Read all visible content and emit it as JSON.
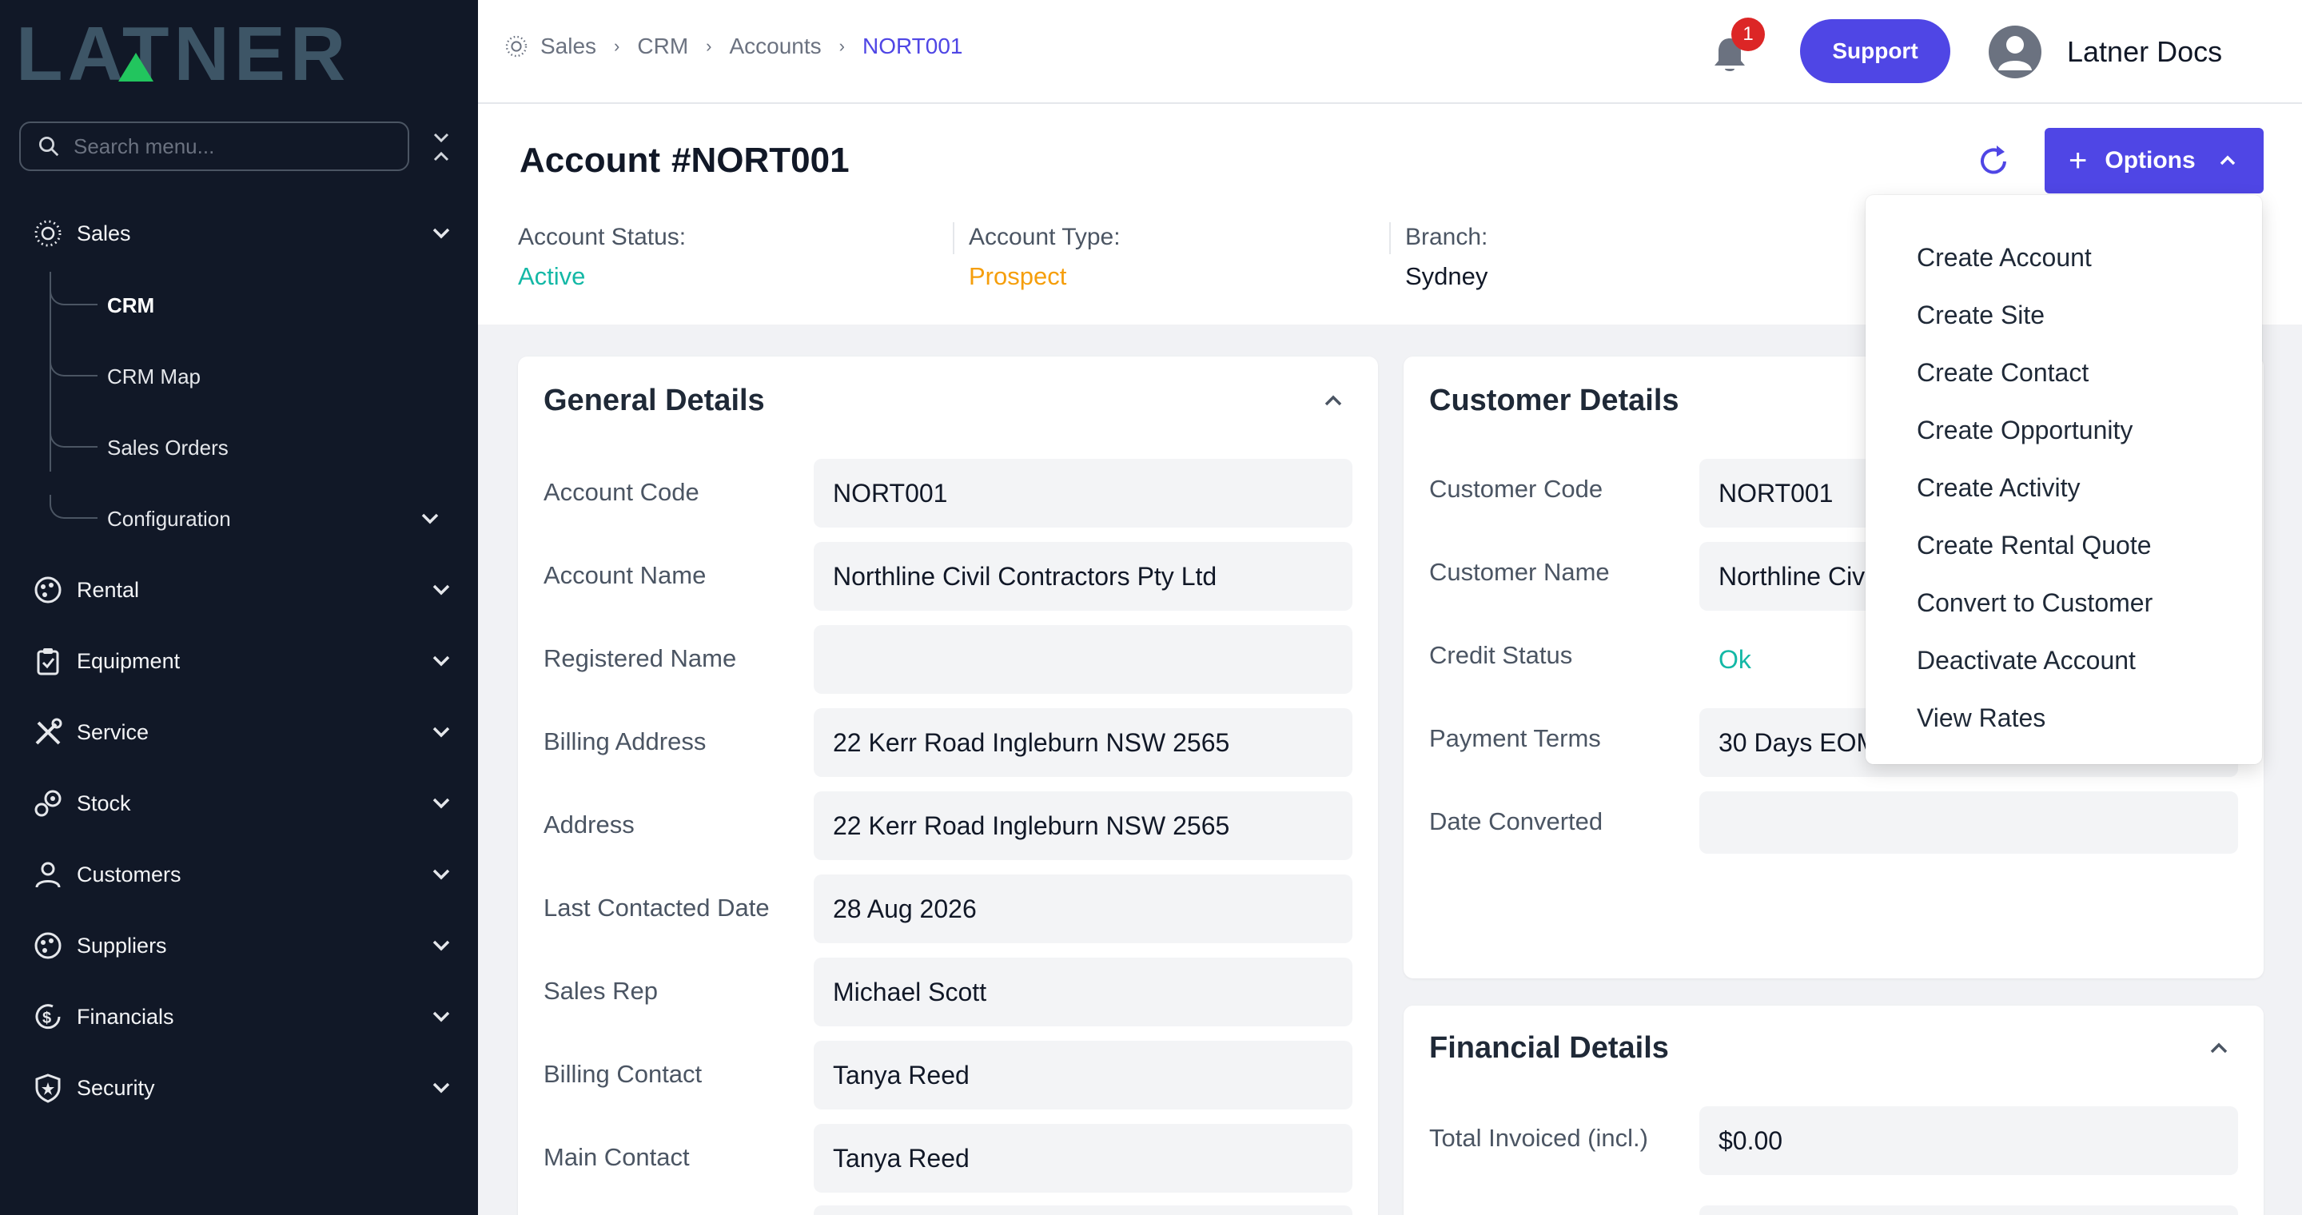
{
  "app": {
    "logo_text": "LATNER"
  },
  "sidebar": {
    "search_placeholder": "Search menu...",
    "items": [
      {
        "label": "Sales",
        "icon": "sales-icon",
        "expanded": true
      },
      {
        "label": "Rental",
        "icon": "rental-icon"
      },
      {
        "label": "Equipment",
        "icon": "equipment-icon"
      },
      {
        "label": "Service",
        "icon": "service-icon"
      },
      {
        "label": "Stock",
        "icon": "stock-icon"
      },
      {
        "label": "Customers",
        "icon": "customers-icon"
      },
      {
        "label": "Suppliers",
        "icon": "suppliers-icon"
      },
      {
        "label": "Financials",
        "icon": "financials-icon"
      },
      {
        "label": "Security",
        "icon": "security-icon"
      }
    ],
    "sales_sub": [
      {
        "label": "CRM",
        "active": true
      },
      {
        "label": "CRM Map"
      },
      {
        "label": "Sales Orders"
      },
      {
        "label": "Configuration"
      }
    ]
  },
  "topbar": {
    "breadcrumb": [
      "Sales",
      "CRM",
      "Accounts",
      "NORT001"
    ],
    "notification_count": "1",
    "support_label": "Support",
    "user_name": "Latner Docs"
  },
  "header": {
    "title_prefix": "Account",
    "title_id": "#NORT001",
    "options_label": "Options",
    "status_label": "Account Status:",
    "status_value": "Active",
    "type_label": "Account Type:",
    "type_value": "Prospect",
    "branch_label": "Branch:",
    "branch_value": "Sydney"
  },
  "colors": {
    "accent": "#4f46e5",
    "active": "#14b8a6",
    "prospect": "#f59e0b",
    "sidebar_bg": "#111827"
  },
  "general_details": {
    "title": "General Details",
    "fields": [
      {
        "label": "Account Code",
        "value": "NORT001"
      },
      {
        "label": "Account Name",
        "value": "Northline Civil Contractors Pty Ltd"
      },
      {
        "label": "Registered Name",
        "value": ""
      },
      {
        "label": "Billing Address",
        "value": "22 Kerr Road Ingleburn NSW 2565"
      },
      {
        "label": "Address",
        "value": "22 Kerr Road Ingleburn NSW 2565"
      },
      {
        "label": "Last Contacted Date",
        "value": "28 Aug 2026"
      },
      {
        "label": "Sales Rep",
        "value": "Michael Scott"
      },
      {
        "label": "Billing Contact",
        "value": "Tanya Reed"
      },
      {
        "label": "Main Contact",
        "value": "Tanya Reed"
      }
    ]
  },
  "customer_details": {
    "title": "Customer Details",
    "fields": [
      {
        "label": "Customer Code",
        "value": "NORT001"
      },
      {
        "label": "Customer Name",
        "value": "Northline Civ"
      },
      {
        "label": "Credit Status",
        "value": "Ok"
      },
      {
        "label": "Payment Terms",
        "value": "30 Days EOM"
      },
      {
        "label": "Date Converted",
        "value": ""
      }
    ]
  },
  "financial_details": {
    "title": "Financial Details",
    "fields": [
      {
        "label": "Total Invoiced (incl.)",
        "value": "$0.00"
      }
    ]
  },
  "options_menu": [
    "Create Account",
    "Create Site",
    "Create Contact",
    "Create Opportunity",
    "Create Activity",
    "Create Rental Quote",
    "Convert to Customer",
    "Deactivate Account",
    "View Rates"
  ]
}
